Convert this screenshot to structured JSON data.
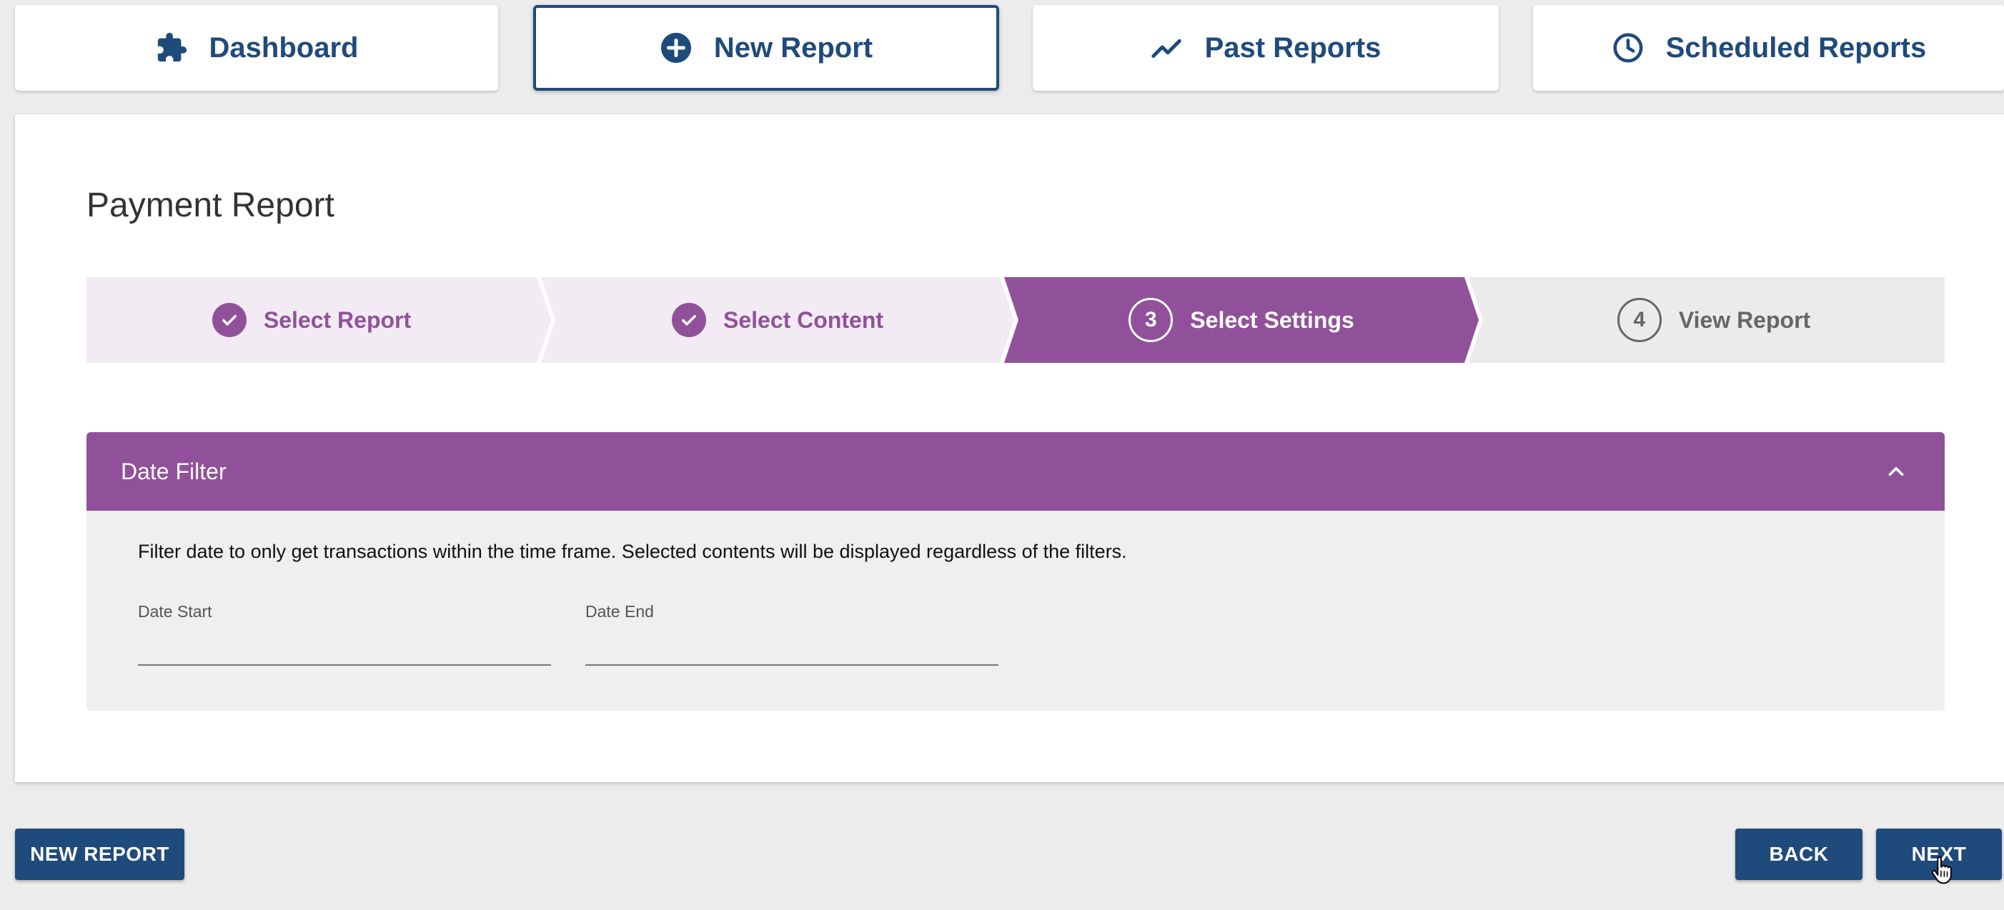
{
  "top_tabs": [
    {
      "label": "Dashboard",
      "icon": "puzzle-icon",
      "active": false
    },
    {
      "label": "New Report",
      "icon": "plus-circle-icon",
      "active": true
    },
    {
      "label": "Past Reports",
      "icon": "trend-line-icon",
      "active": false
    },
    {
      "label": "Scheduled Reports",
      "icon": "clock-icon",
      "active": false
    }
  ],
  "page_title": "Payment Report",
  "stepper": {
    "steps": [
      {
        "label": "Select Report",
        "state": "done"
      },
      {
        "label": "Select Content",
        "state": "done"
      },
      {
        "label": "Select Settings",
        "state": "current",
        "number": "3"
      },
      {
        "label": "View Report",
        "state": "future",
        "number": "4"
      }
    ],
    "colors": {
      "done_bg": "#f3ebf4",
      "current_bg": "#91519a",
      "future_bg": "#ebebeb",
      "accent": "#91519a"
    }
  },
  "date_filter": {
    "title": "Date Filter",
    "description": "Filter date to only get transactions within the time frame. Selected contents will be displayed regardless of the filters.",
    "date_start": {
      "label": "Date Start",
      "value": ""
    },
    "date_end": {
      "label": "Date End",
      "value": ""
    }
  },
  "buttons": {
    "new_report": "NEW REPORT",
    "back": "BACK",
    "next": "NEXT"
  },
  "colors": {
    "primary": "#1f4a7c",
    "accent": "#91519a",
    "background": "#ececec"
  }
}
